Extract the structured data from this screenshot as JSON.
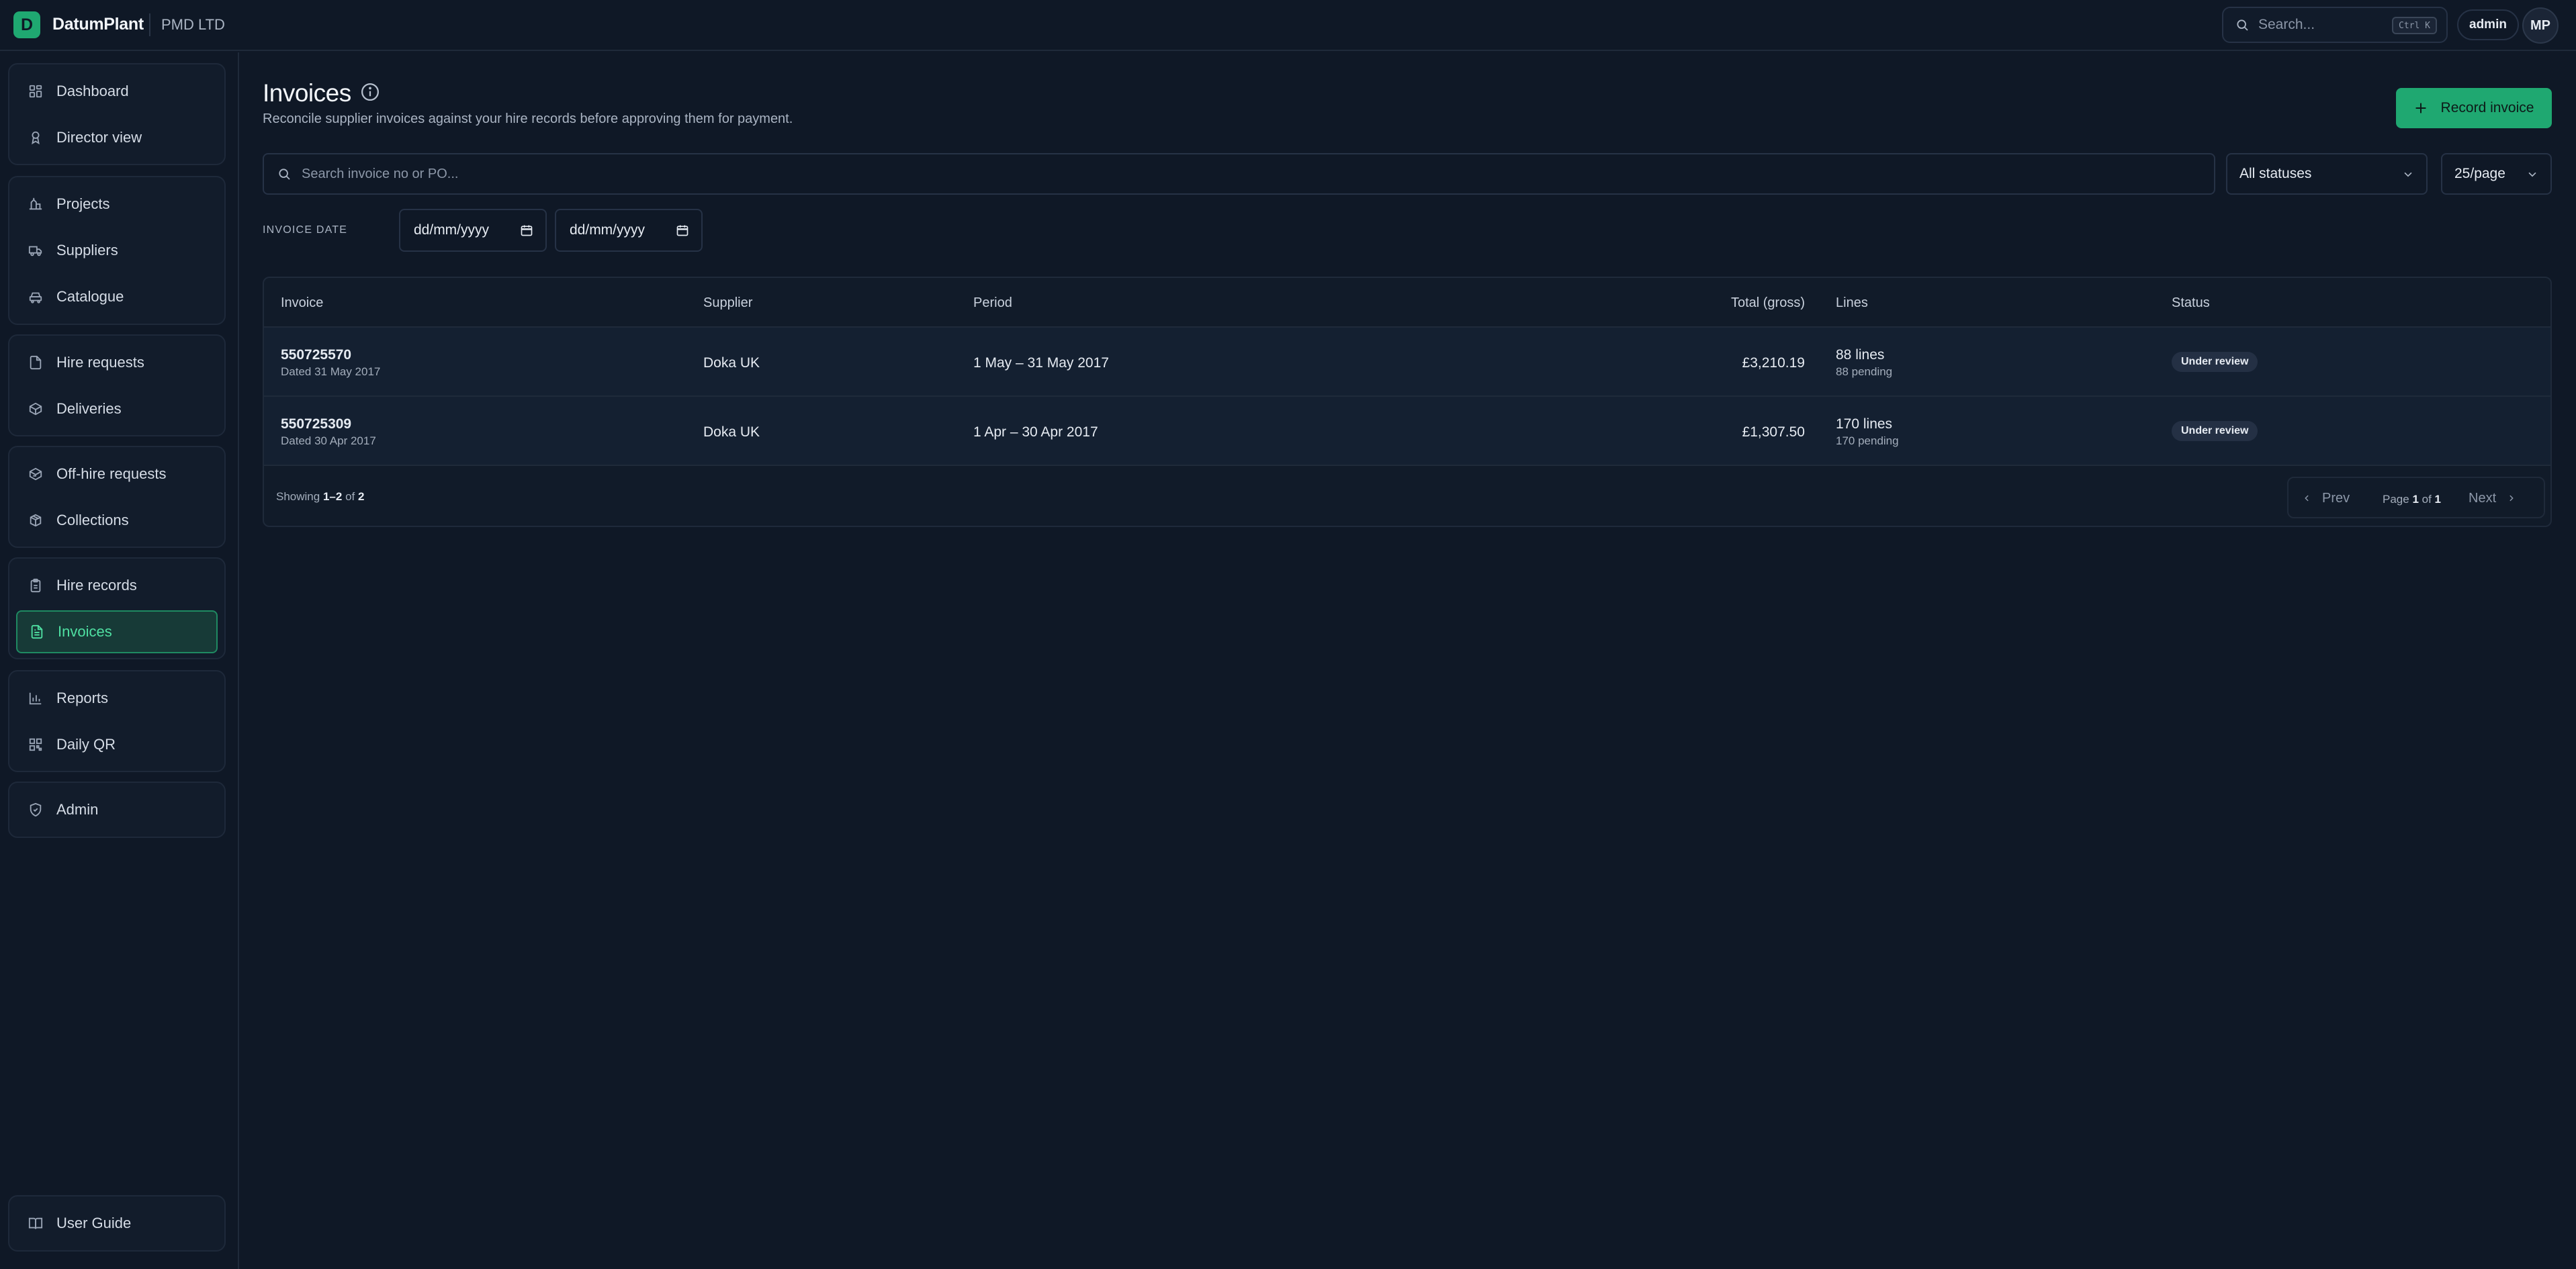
{
  "topbar": {
    "logo_letter": "D",
    "brand": "DatumPlant",
    "org": "PMD LTD",
    "search_label": "Search...",
    "search_shortcut": "Ctrl K",
    "user_role": "admin",
    "avatar_initials": "MP"
  },
  "sidebar": {
    "items": [
      {
        "label": "Dashboard",
        "icon": "dashboard-icon"
      },
      {
        "label": "Director view",
        "icon": "award-icon"
      },
      {
        "label": "Projects",
        "icon": "projects-icon"
      },
      {
        "label": "Suppliers",
        "icon": "truck-icon"
      },
      {
        "label": "Catalogue",
        "icon": "catalogue-icon"
      },
      {
        "label": "Hire requests",
        "icon": "file-icon"
      },
      {
        "label": "Deliveries",
        "icon": "package-icon"
      },
      {
        "label": "Off-hire requests",
        "icon": "package-return-icon"
      },
      {
        "label": "Collections",
        "icon": "boxes-icon"
      },
      {
        "label": "Hire records",
        "icon": "clipboard-icon"
      },
      {
        "label": "Invoices",
        "icon": "invoice-icon",
        "active": true
      },
      {
        "label": "Reports",
        "icon": "bar-chart-icon"
      },
      {
        "label": "Daily QR",
        "icon": "qr-icon"
      },
      {
        "label": "Admin",
        "icon": "shield-icon"
      },
      {
        "label": "User Guide",
        "icon": "book-icon"
      }
    ]
  },
  "main": {
    "title": "Invoices",
    "subtitle": "Reconcile supplier invoices against your hire records before approving them for payment.",
    "record_button": "Record invoice",
    "search_placeholder": "Search invoice no or PO...",
    "status_filter": "All statuses",
    "page_size": "25/page",
    "date_label": "INVOICE DATE",
    "date_from": "dd/mm/yyyy",
    "date_to": "dd/mm/yyyy"
  },
  "table": {
    "columns": [
      "Invoice",
      "Supplier",
      "Period",
      "Total (gross)",
      "Lines",
      "Status"
    ],
    "rows": [
      {
        "invoice": "550725570",
        "dated": "Dated 31 May 2017",
        "supplier": "Doka UK",
        "period": "1 May – 31 May 2017",
        "total": "£3,210.19",
        "lines": "88 lines",
        "pending": "88 pending",
        "status": "Under review"
      },
      {
        "invoice": "550725309",
        "dated": "Dated 30 Apr 2017",
        "supplier": "Doka UK",
        "period": "1 Apr – 30 Apr 2017",
        "total": "£1,307.50",
        "lines": "170 lines",
        "pending": "170 pending",
        "status": "Under review"
      }
    ],
    "footer": {
      "showing_prefix": "Showing ",
      "range_start": "1",
      "range_sep": "–",
      "range_end": "2",
      "of": " of ",
      "total": "2",
      "prev": "Prev",
      "next": "Next",
      "page_word": "Page ",
      "page_current": "1",
      "page_of": " of ",
      "page_total": "1"
    }
  },
  "colors": {
    "background": "#0f1826",
    "accent": "#1fa871",
    "active_text": "#4fe0a2"
  }
}
